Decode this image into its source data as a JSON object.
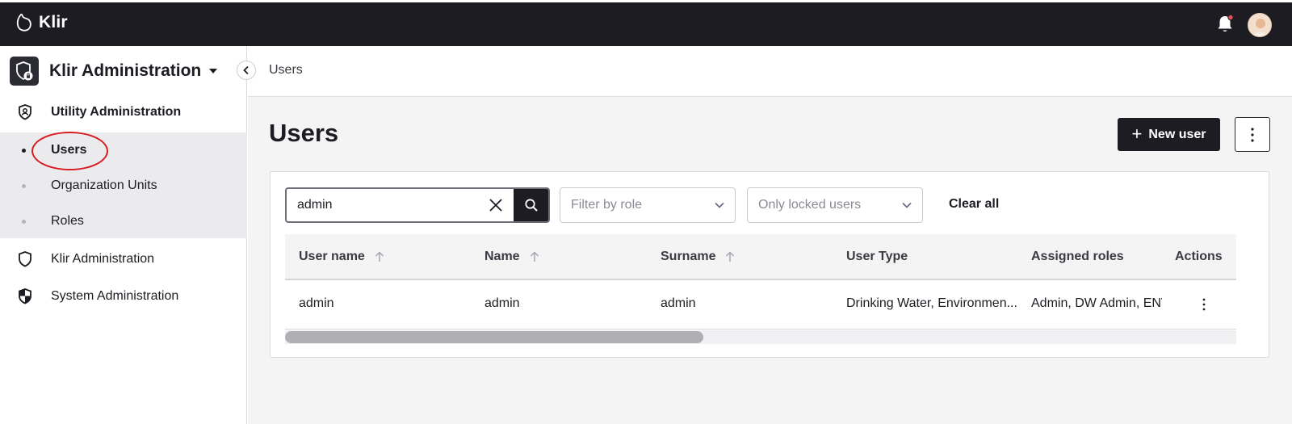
{
  "app": {
    "name": "Klir"
  },
  "header": {
    "has_notification": true
  },
  "sidebar": {
    "title": "Klir Administration",
    "groups": [
      {
        "label": "Utility Administration",
        "icon": "shield-icon"
      },
      {
        "label": "Klir Administration",
        "icon": "shield-outline-icon"
      },
      {
        "label": "System Administration",
        "icon": "shield-half-icon"
      }
    ],
    "sub_items": [
      {
        "label": "Users",
        "active": true
      },
      {
        "label": "Organization Units",
        "active": false
      },
      {
        "label": "Roles",
        "active": false
      }
    ]
  },
  "breadcrumb": {
    "current": "Users"
  },
  "page": {
    "title": "Users",
    "new_user_label": "New user"
  },
  "filters": {
    "search_value": "admin",
    "role_placeholder": "Filter by role",
    "locked_placeholder": "Only locked users",
    "clear_all_label": "Clear all"
  },
  "table": {
    "columns": [
      "User name",
      "Name",
      "Surname",
      "User Type",
      "Assigned roles",
      "Actions"
    ],
    "rows": [
      {
        "user_name": "admin",
        "name": "admin",
        "surname": "admin",
        "user_type": "Drinking Water, Environmen...",
        "assigned_roles": "Admin, DW Admin, ENV"
      }
    ],
    "scroll_fraction": 0.44
  },
  "colors": {
    "topbar": "#1c1c22",
    "accent": "#1c1c22",
    "annotation": "#d81b22"
  }
}
